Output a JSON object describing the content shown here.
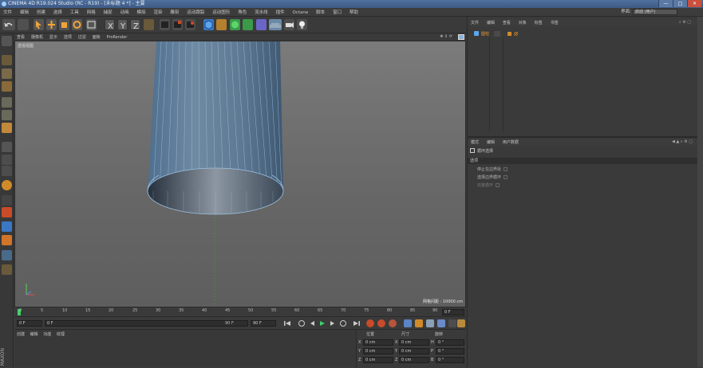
{
  "window": {
    "title": "CINEMA 4D R19.024 Studio (RC - R19) - [未标题 4 *] - 主要",
    "min": "—",
    "max": "□",
    "close": "✕"
  },
  "menubar": {
    "items": [
      "文件",
      "编辑",
      "创建",
      "选择",
      "工具",
      "网格",
      "捕捉",
      "动画",
      "模拟",
      "渲染",
      "雕刻",
      "运动跟踪",
      "运动图形",
      "角色",
      "流水线",
      "插件",
      "Octane",
      "脚本",
      "窗口",
      "帮助"
    ],
    "layout_label": "界面:",
    "layout_value": "启动 (用户)"
  },
  "viewport_menu": {
    "items": [
      "查看",
      "摄像机",
      "显示",
      "选项",
      "过滤",
      "面板",
      "ProRender"
    ]
  },
  "viewport": {
    "label": "透视视图",
    "grid_spacing": "网格间距 : 10000 cm"
  },
  "timeline": {
    "ticks": [
      "0",
      "5",
      "10",
      "15",
      "20",
      "25",
      "30",
      "35",
      "40",
      "45",
      "50",
      "55",
      "60",
      "65",
      "70",
      "75",
      "80",
      "85",
      "90"
    ],
    "frame_readout": "0 F"
  },
  "playback": {
    "start_field": "0 F",
    "current_field": "0 F",
    "end_field": "90 F",
    "max_field": "90 F"
  },
  "material_menu": {
    "items": [
      "创建",
      "编辑",
      "功能",
      "纹理"
    ]
  },
  "coordinates": {
    "headers": [
      "位置",
      "尺寸",
      "旋转"
    ],
    "rows": [
      {
        "axis": "X",
        "pos": "0 cm",
        "sizeaxis": "X",
        "size": "0 cm",
        "rotaxis": "H",
        "rot": "0 °"
      },
      {
        "axis": "Y",
        "pos": "0 cm",
        "sizeaxis": "Y",
        "size": "0 cm",
        "rotaxis": "P",
        "rot": "0 °"
      },
      {
        "axis": "Z",
        "pos": "0 cm",
        "sizeaxis": "Z",
        "size": "0 cm",
        "rotaxis": "B",
        "rot": "0 °"
      }
    ]
  },
  "object_manager": {
    "menu": [
      "文件",
      "编辑",
      "查看",
      "对象",
      "标签",
      "书签"
    ],
    "object_name": "圆柱"
  },
  "attribute_manager": {
    "menu": [
      "模式",
      "编辑",
      "用户数据"
    ],
    "mode_title": "循环选择",
    "section": "选项",
    "options": [
      "停止在边界处",
      "选择边界循环",
      "完整循环"
    ]
  },
  "brand": "MAXON"
}
